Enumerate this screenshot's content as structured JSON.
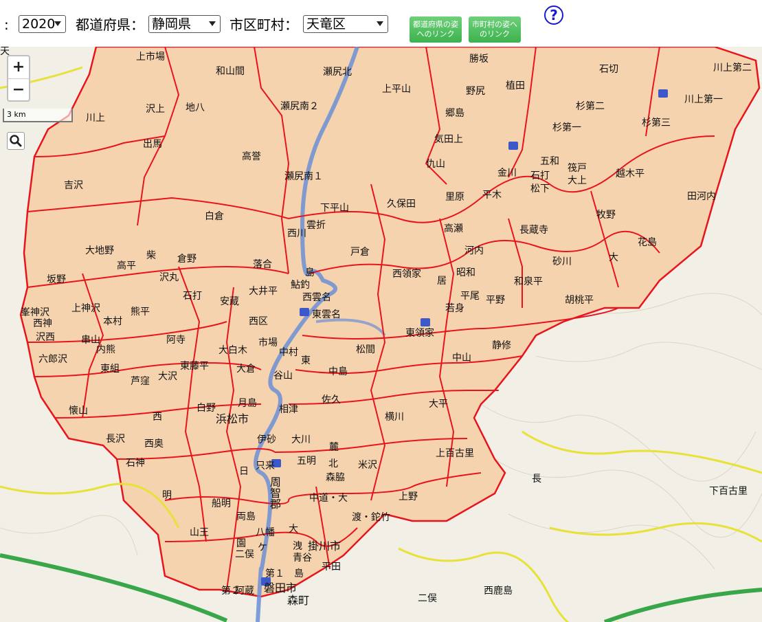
{
  "toolbar": {
    "year_prefix": ":",
    "year_value": "2020",
    "prefecture_label": "都道府県：",
    "prefecture_value": "静岡県",
    "municipality_label": "市区町村：",
    "municipality_value": "天竜区",
    "pref_link_button": "都道府県の姿へのリンク",
    "muni_link_button": "市町村の姿へのリンク",
    "help": "?"
  },
  "map_controls": {
    "zoom_in": "+",
    "zoom_out": "−",
    "scale": "3 km"
  },
  "colors": {
    "boundary": "#e8141c",
    "district_fill": "#f6cfa8",
    "river": "#6b8fd6",
    "road_yellow": "#e7e23a",
    "expressway": "#3aa64a",
    "link_button": "#45b555",
    "help": "#1a1acc"
  },
  "labels": [
    "上市場",
    "和山間",
    "瀬尻北",
    "勝坂",
    "石切",
    "川上第二",
    "上平山",
    "植田",
    "野尻",
    "杉第二",
    "川上第一",
    "地八",
    "沢上",
    "川上",
    "瀬尻南２",
    "郷島",
    "杉第一",
    "杉第三",
    "出馬",
    "気田上",
    "高誉",
    "吉沢",
    "仇山",
    "金川",
    "五和",
    "筏戸",
    "越木平",
    "石打",
    "大上",
    "松下",
    "瀬尻南１",
    "平木",
    "里原",
    "田河内",
    "久保田",
    "下平山",
    "白倉",
    "牧野",
    "雲折",
    "長蔵寺",
    "高瀬",
    "西川",
    "花島",
    "戸倉",
    "河内",
    "大地野",
    "柴",
    "高平",
    "落合",
    "大",
    "倉野",
    "砂川",
    "坂野",
    "島",
    "西領家",
    "昭和",
    "沢丸",
    "和泉平",
    "大井平",
    "鮎釣",
    "居",
    "石打",
    "平尾",
    "熊平",
    "平野",
    "胡桃平",
    "峯神沢",
    "西雲名",
    "安蔵",
    "若身",
    "上神沢",
    "西神",
    "本村",
    "東雲名",
    "西区",
    "東領家",
    "沢西",
    "阿寺",
    "串山",
    "市場",
    "静修",
    "大白木",
    "中村",
    "東",
    "内熊",
    "松間",
    "六郎沢",
    "東藤平",
    "大倉",
    "中山",
    "谷山",
    "東組",
    "大沢",
    "中島",
    "芦窪",
    "佐久",
    "月島",
    "白野",
    "大平",
    "相津",
    "懐山",
    "西",
    "横川",
    "浜松市",
    "長沢",
    "伊砂",
    "大川",
    "西奥",
    "麓",
    "上百古里",
    "五明",
    "北",
    "石神",
    "米沢",
    "日",
    "只来",
    "森脇",
    "長",
    "明",
    "周智郡",
    "上野",
    "船明",
    "中道・大",
    "両島",
    "渡・鉈竹",
    "下百古里",
    "大",
    "掛川市",
    "八幡",
    "洩",
    "園",
    "山王",
    "青谷",
    "ケ",
    "二俣",
    "島",
    "第１",
    "阿蔵",
    "平田",
    "二俣",
    "磐田市",
    "第２",
    "西鹿島",
    "森町",
    "天"
  ]
}
